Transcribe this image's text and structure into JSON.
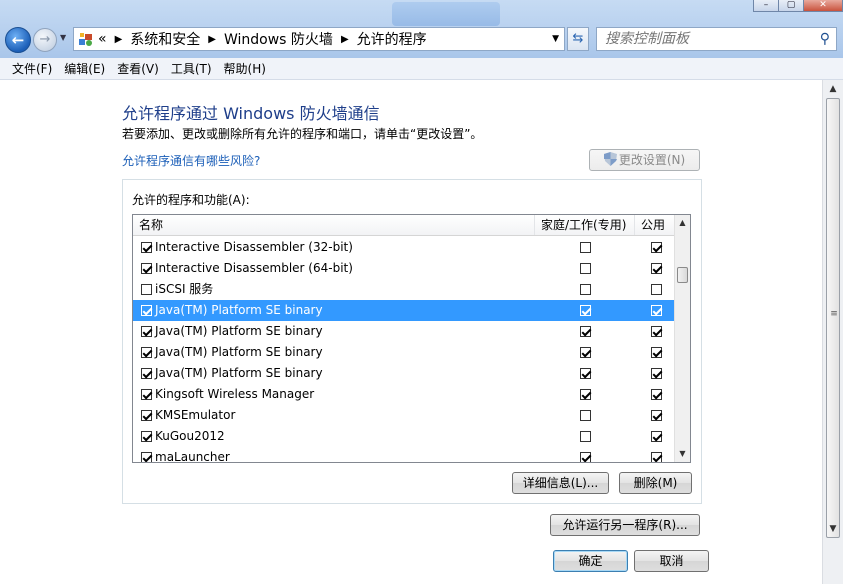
{
  "address": {
    "overflow": "«",
    "crumbs": [
      "系统和安全",
      "Windows 防火墙",
      "允许的程序"
    ]
  },
  "search": {
    "placeholder": "搜索控制面板"
  },
  "menu": [
    "文件(F)",
    "编辑(E)",
    "查看(V)",
    "工具(T)",
    "帮助(H)"
  ],
  "page": {
    "title": "允许程序通过 Windows 防火墙通信",
    "description": "若要添加、更改或删除所有允许的程序和端口，请单击“更改设置”。",
    "risk_link": "允许程序通信有哪些风险?",
    "change_settings_label": "更改设置(N)"
  },
  "list": {
    "group_label": "允许的程序和功能(A):",
    "columns": {
      "name": "名称",
      "home": "家庭/工作(专用)",
      "public": "公用"
    },
    "rows": [
      {
        "name": "Interactive Disassembler (32-bit)",
        "enabled": true,
        "home": false,
        "public": true,
        "selected": false
      },
      {
        "name": "Interactive Disassembler (64-bit)",
        "enabled": true,
        "home": false,
        "public": true,
        "selected": false
      },
      {
        "name": "iSCSI 服务",
        "enabled": false,
        "home": false,
        "public": false,
        "selected": false
      },
      {
        "name": "Java(TM) Platform SE binary",
        "enabled": true,
        "home": true,
        "public": true,
        "selected": true
      },
      {
        "name": "Java(TM) Platform SE binary",
        "enabled": true,
        "home": true,
        "public": true,
        "selected": false
      },
      {
        "name": "Java(TM) Platform SE binary",
        "enabled": true,
        "home": true,
        "public": true,
        "selected": false
      },
      {
        "name": "Java(TM) Platform SE binary",
        "enabled": true,
        "home": true,
        "public": true,
        "selected": false
      },
      {
        "name": "Kingsoft Wireless Manager",
        "enabled": true,
        "home": true,
        "public": true,
        "selected": false
      },
      {
        "name": "KMSEmulator",
        "enabled": true,
        "home": false,
        "public": true,
        "selected": false
      },
      {
        "name": "KuGou2012",
        "enabled": true,
        "home": false,
        "public": true,
        "selected": false
      },
      {
        "name": "maLauncher",
        "enabled": true,
        "home": true,
        "public": true,
        "selected": false
      }
    ]
  },
  "buttons": {
    "details": "详细信息(L)...",
    "remove": "删除(M)",
    "allow_another": "允许运行另一程序(R)...",
    "ok": "确定",
    "cancel": "取消"
  }
}
